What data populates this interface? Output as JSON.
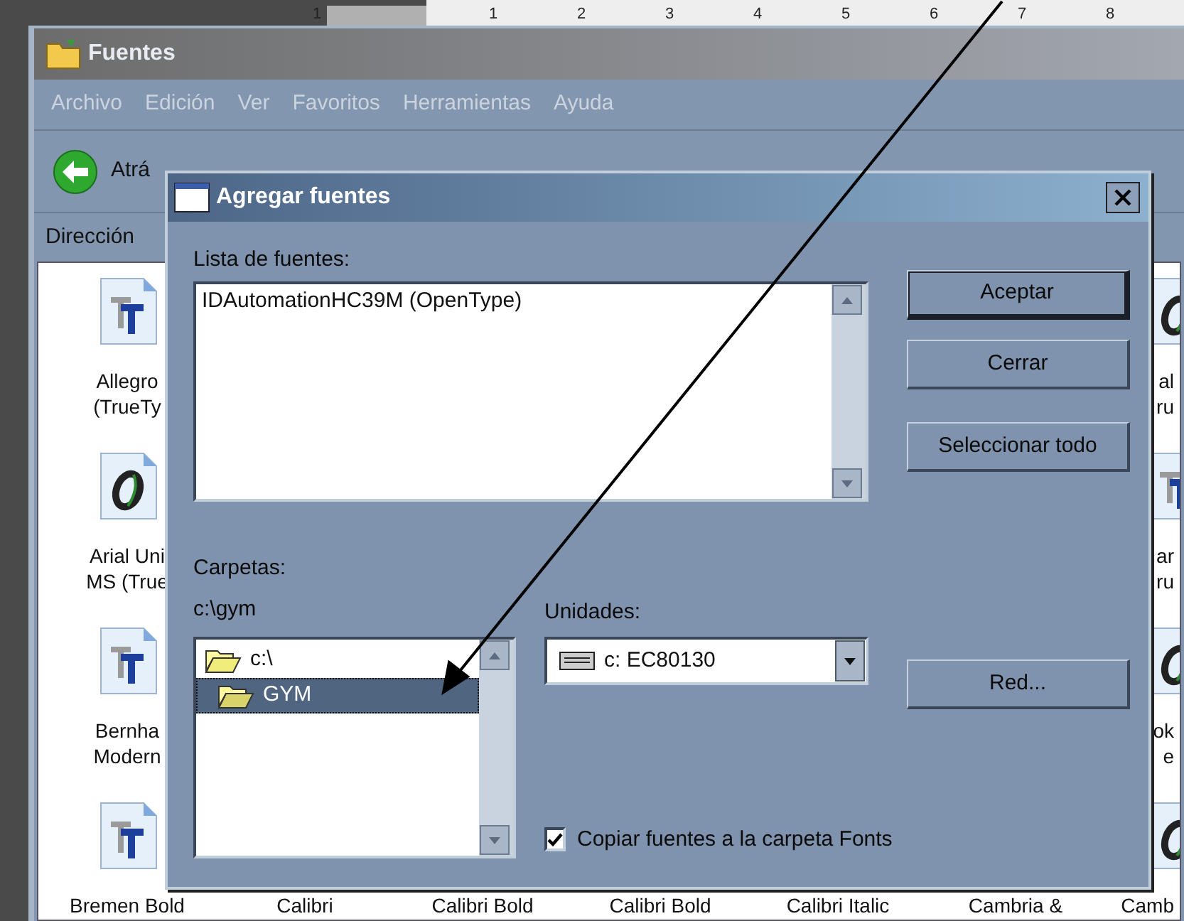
{
  "ruler": {
    "numbers": [
      "1",
      "1",
      "2",
      "3",
      "4",
      "5",
      "6",
      "7",
      "8"
    ]
  },
  "explorer": {
    "title": "Fuentes",
    "menu": [
      "Archivo",
      "Edición",
      "Ver",
      "Favoritos",
      "Herramientas",
      "Ayuda"
    ],
    "back_label": "Atrá",
    "address_label": "Dirección",
    "icon_rows": [
      [
        {
          "kind": "truetype",
          "lines": [
            "Allegro",
            "(TrueTy"
          ]
        },
        {
          "kind": "hidden"
        },
        {
          "kind": "hidden"
        },
        {
          "kind": "hidden"
        },
        {
          "kind": "hidden"
        },
        {
          "kind": "hidden"
        },
        {
          "kind": "opentype",
          "lines": [
            "al",
            "ru"
          ]
        }
      ],
      [
        {
          "kind": "opentype",
          "lines": [
            "Arial Uni",
            "MS (True"
          ]
        },
        {
          "kind": "hidden"
        },
        {
          "kind": "hidden"
        },
        {
          "kind": "hidden"
        },
        {
          "kind": "hidden"
        },
        {
          "kind": "hidden"
        },
        {
          "kind": "truetype",
          "lines": [
            "ar",
            "ru"
          ]
        }
      ],
      [
        {
          "kind": "truetype",
          "lines": [
            "Bernha",
            "Modern"
          ]
        },
        {
          "kind": "hidden"
        },
        {
          "kind": "hidden"
        },
        {
          "kind": "hidden"
        },
        {
          "kind": "hidden"
        },
        {
          "kind": "hidden"
        },
        {
          "kind": "opentype",
          "lines": [
            "ok",
            "e"
          ]
        }
      ],
      [
        {
          "kind": "truetype",
          "lines": [
            "Bremen Bold"
          ]
        },
        {
          "kind": "label_only",
          "lines": [
            "Calibri"
          ]
        },
        {
          "kind": "label_only",
          "lines": [
            "Calibri Bold"
          ]
        },
        {
          "kind": "label_only",
          "lines": [
            "Calibri Bold"
          ]
        },
        {
          "kind": "label_only",
          "lines": [
            "Calibri Italic"
          ]
        },
        {
          "kind": "label_only",
          "lines": [
            "Cambria &"
          ]
        },
        {
          "kind": "opentype",
          "lines": [
            "Camb"
          ]
        }
      ]
    ]
  },
  "dialog": {
    "title": "Agregar fuentes",
    "font_list_label": "Lista de fuentes:",
    "font_list": [
      "IDAutomationHC39M (OpenType)"
    ],
    "folders_label": "Carpetas:",
    "current_path": "c:\\gym",
    "folders": [
      {
        "name": "c:\\",
        "selected": false
      },
      {
        "name": "GYM",
        "selected": true
      }
    ],
    "drives_label": "Unidades:",
    "drive": "c: EC80130",
    "copy_checkbox": {
      "label": "Copiar fuentes a la carpeta Fonts",
      "checked": true
    },
    "buttons": [
      {
        "label": "Aceptar",
        "default": true
      },
      {
        "label": "Cerrar",
        "default": false
      },
      {
        "label": "Seleccionar todo",
        "default": false
      },
      {
        "label": "Red...",
        "default": false
      }
    ]
  }
}
